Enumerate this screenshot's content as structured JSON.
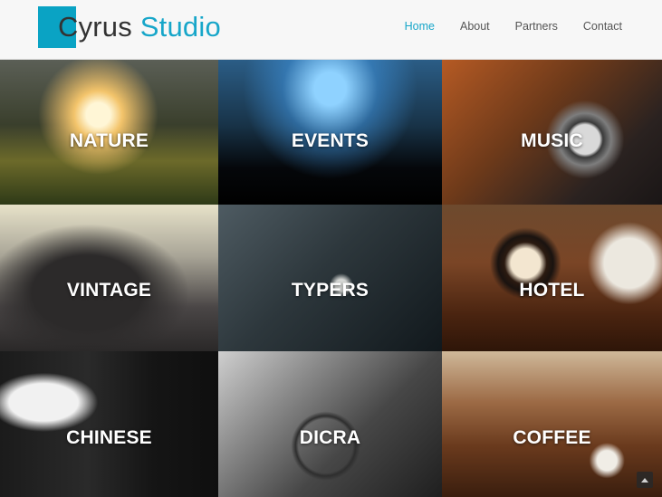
{
  "brand": {
    "first": "Cyrus",
    "second": "Studio",
    "accent_color": "#17a6c9",
    "block_color": "#0aa3c4"
  },
  "nav": [
    {
      "label": "Home",
      "active": true
    },
    {
      "label": "About",
      "active": false
    },
    {
      "label": "Partners",
      "active": false
    },
    {
      "label": "Contact",
      "active": false
    }
  ],
  "tiles": [
    {
      "label": "NATURE"
    },
    {
      "label": "EVENTS"
    },
    {
      "label": "MUSIC"
    },
    {
      "label": "VINTAGE"
    },
    {
      "label": "TYPERS"
    },
    {
      "label": "HOTEL"
    },
    {
      "label": "CHINESE"
    },
    {
      "label": "DICRA"
    },
    {
      "label": "COFFEE"
    }
  ],
  "scroll_top_icon": "arrow-up-icon"
}
